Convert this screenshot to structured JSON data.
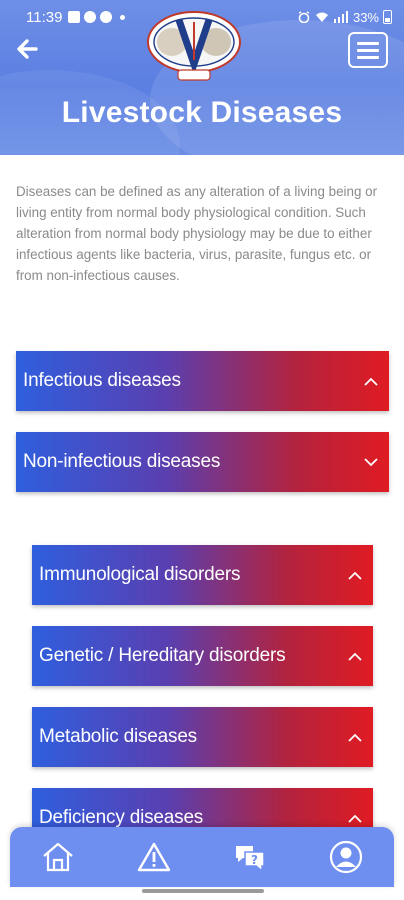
{
  "status_bar": {
    "time": "11:39",
    "battery": "33%"
  },
  "header": {
    "title": "Livestock Diseases",
    "back_icon": "arrow-left-icon",
    "menu_icon": "hamburger-menu-icon",
    "logo": "veterinary-college-logo"
  },
  "intro_text": "Diseases can be defined as any alteration of a living being or living entity from normal body physiological condition. Such alteration from normal body physiology may be due to either infectious agents like bacteria, virus, parasite, fungus etc. or from non-infectious causes.",
  "sections": [
    {
      "label": "Infectious diseases",
      "expanded": true
    },
    {
      "label": "Non-infectious diseases",
      "expanded": false
    }
  ],
  "sub_sections": [
    {
      "label": "Immunological disorders",
      "expanded": true
    },
    {
      "label": "Genetic / Hereditary disorders",
      "expanded": true
    },
    {
      "label": "Metabolic diseases",
      "expanded": true
    },
    {
      "label": "Deficiency diseases",
      "expanded": true
    }
  ],
  "bottom_nav": [
    {
      "icon": "home-icon"
    },
    {
      "icon": "warning-icon"
    },
    {
      "icon": "question-chat-icon"
    },
    {
      "icon": "user-profile-icon"
    }
  ],
  "colors": {
    "header_blue": "#5b7fe2",
    "accordion_start": "#2f5fde",
    "accordion_end": "#e01b23",
    "nav_bg": "#6f8ff0"
  }
}
